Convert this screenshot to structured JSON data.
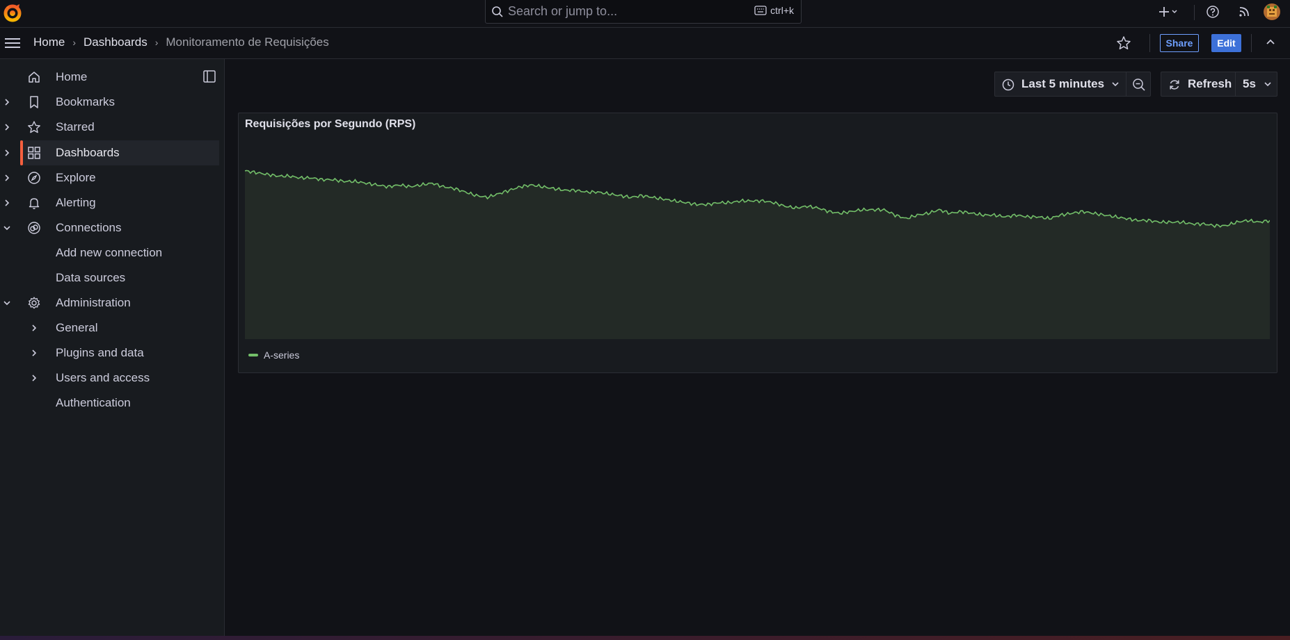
{
  "topbar": {
    "search_placeholder": "Search or jump to...",
    "search_shortcut": "ctrl+k",
    "icons": [
      "grafana-logo-icon",
      "search-icon",
      "keyboard-icon",
      "plus-icon",
      "help-icon",
      "rss-icon",
      "avatar"
    ]
  },
  "navbar": {
    "breadcrumbs": [
      "Home",
      "Dashboards",
      "Monitoramento de Requisições"
    ],
    "share_label": "Share",
    "edit_label": "Edit"
  },
  "sidebar": {
    "items": [
      {
        "label": "Home",
        "icon": "home-icon"
      },
      {
        "label": "Bookmarks",
        "icon": "bookmark-icon"
      },
      {
        "label": "Starred",
        "icon": "star-icon"
      },
      {
        "label": "Dashboards",
        "icon": "apps-icon",
        "active": true
      },
      {
        "label": "Explore",
        "icon": "compass-icon"
      },
      {
        "label": "Alerting",
        "icon": "bell-icon"
      },
      {
        "label": "Connections",
        "icon": "link-icon"
      },
      {
        "label": "Add new connection"
      },
      {
        "label": "Data sources"
      },
      {
        "label": "Administration",
        "icon": "gear-icon"
      },
      {
        "label": "General"
      },
      {
        "label": "Plugins and data"
      },
      {
        "label": "Users and access"
      },
      {
        "label": "Authentication"
      }
    ]
  },
  "toolbar": {
    "time_range": "Last 5 minutes",
    "refresh_label": "Refresh",
    "refresh_interval": "5s"
  },
  "panel": {
    "title": "Requisições por Segundo (RPS)",
    "legend_label": "A-series"
  },
  "colors": {
    "series": "#73bf69",
    "accent": "#f55f3e",
    "primary": "#3d71d9"
  },
  "chart_data": {
    "type": "area",
    "series": [
      {
        "name": "A-series",
        "values": [
          95,
          94,
          93,
          92,
          92,
          91,
          91,
          90,
          90,
          89,
          89,
          88,
          87,
          86,
          87,
          86,
          87,
          88,
          86,
          85,
          83,
          81,
          80,
          82,
          84,
          86,
          87,
          86,
          85,
          84,
          84,
          83,
          83,
          82,
          81,
          80,
          81,
          80,
          79,
          78,
          77,
          76,
          76,
          77,
          77,
          78,
          78,
          78,
          77,
          75,
          74,
          75,
          74,
          72,
          71,
          72,
          73,
          73,
          73,
          70,
          68,
          70,
          71,
          73,
          71,
          72,
          71,
          70,
          70,
          69,
          70,
          69,
          69,
          68,
          70,
          71,
          72,
          71,
          70,
          69,
          68,
          67,
          67,
          66,
          66,
          66,
          65,
          65,
          64,
          64,
          66,
          67,
          66,
          67
        ]
      }
    ]
  }
}
